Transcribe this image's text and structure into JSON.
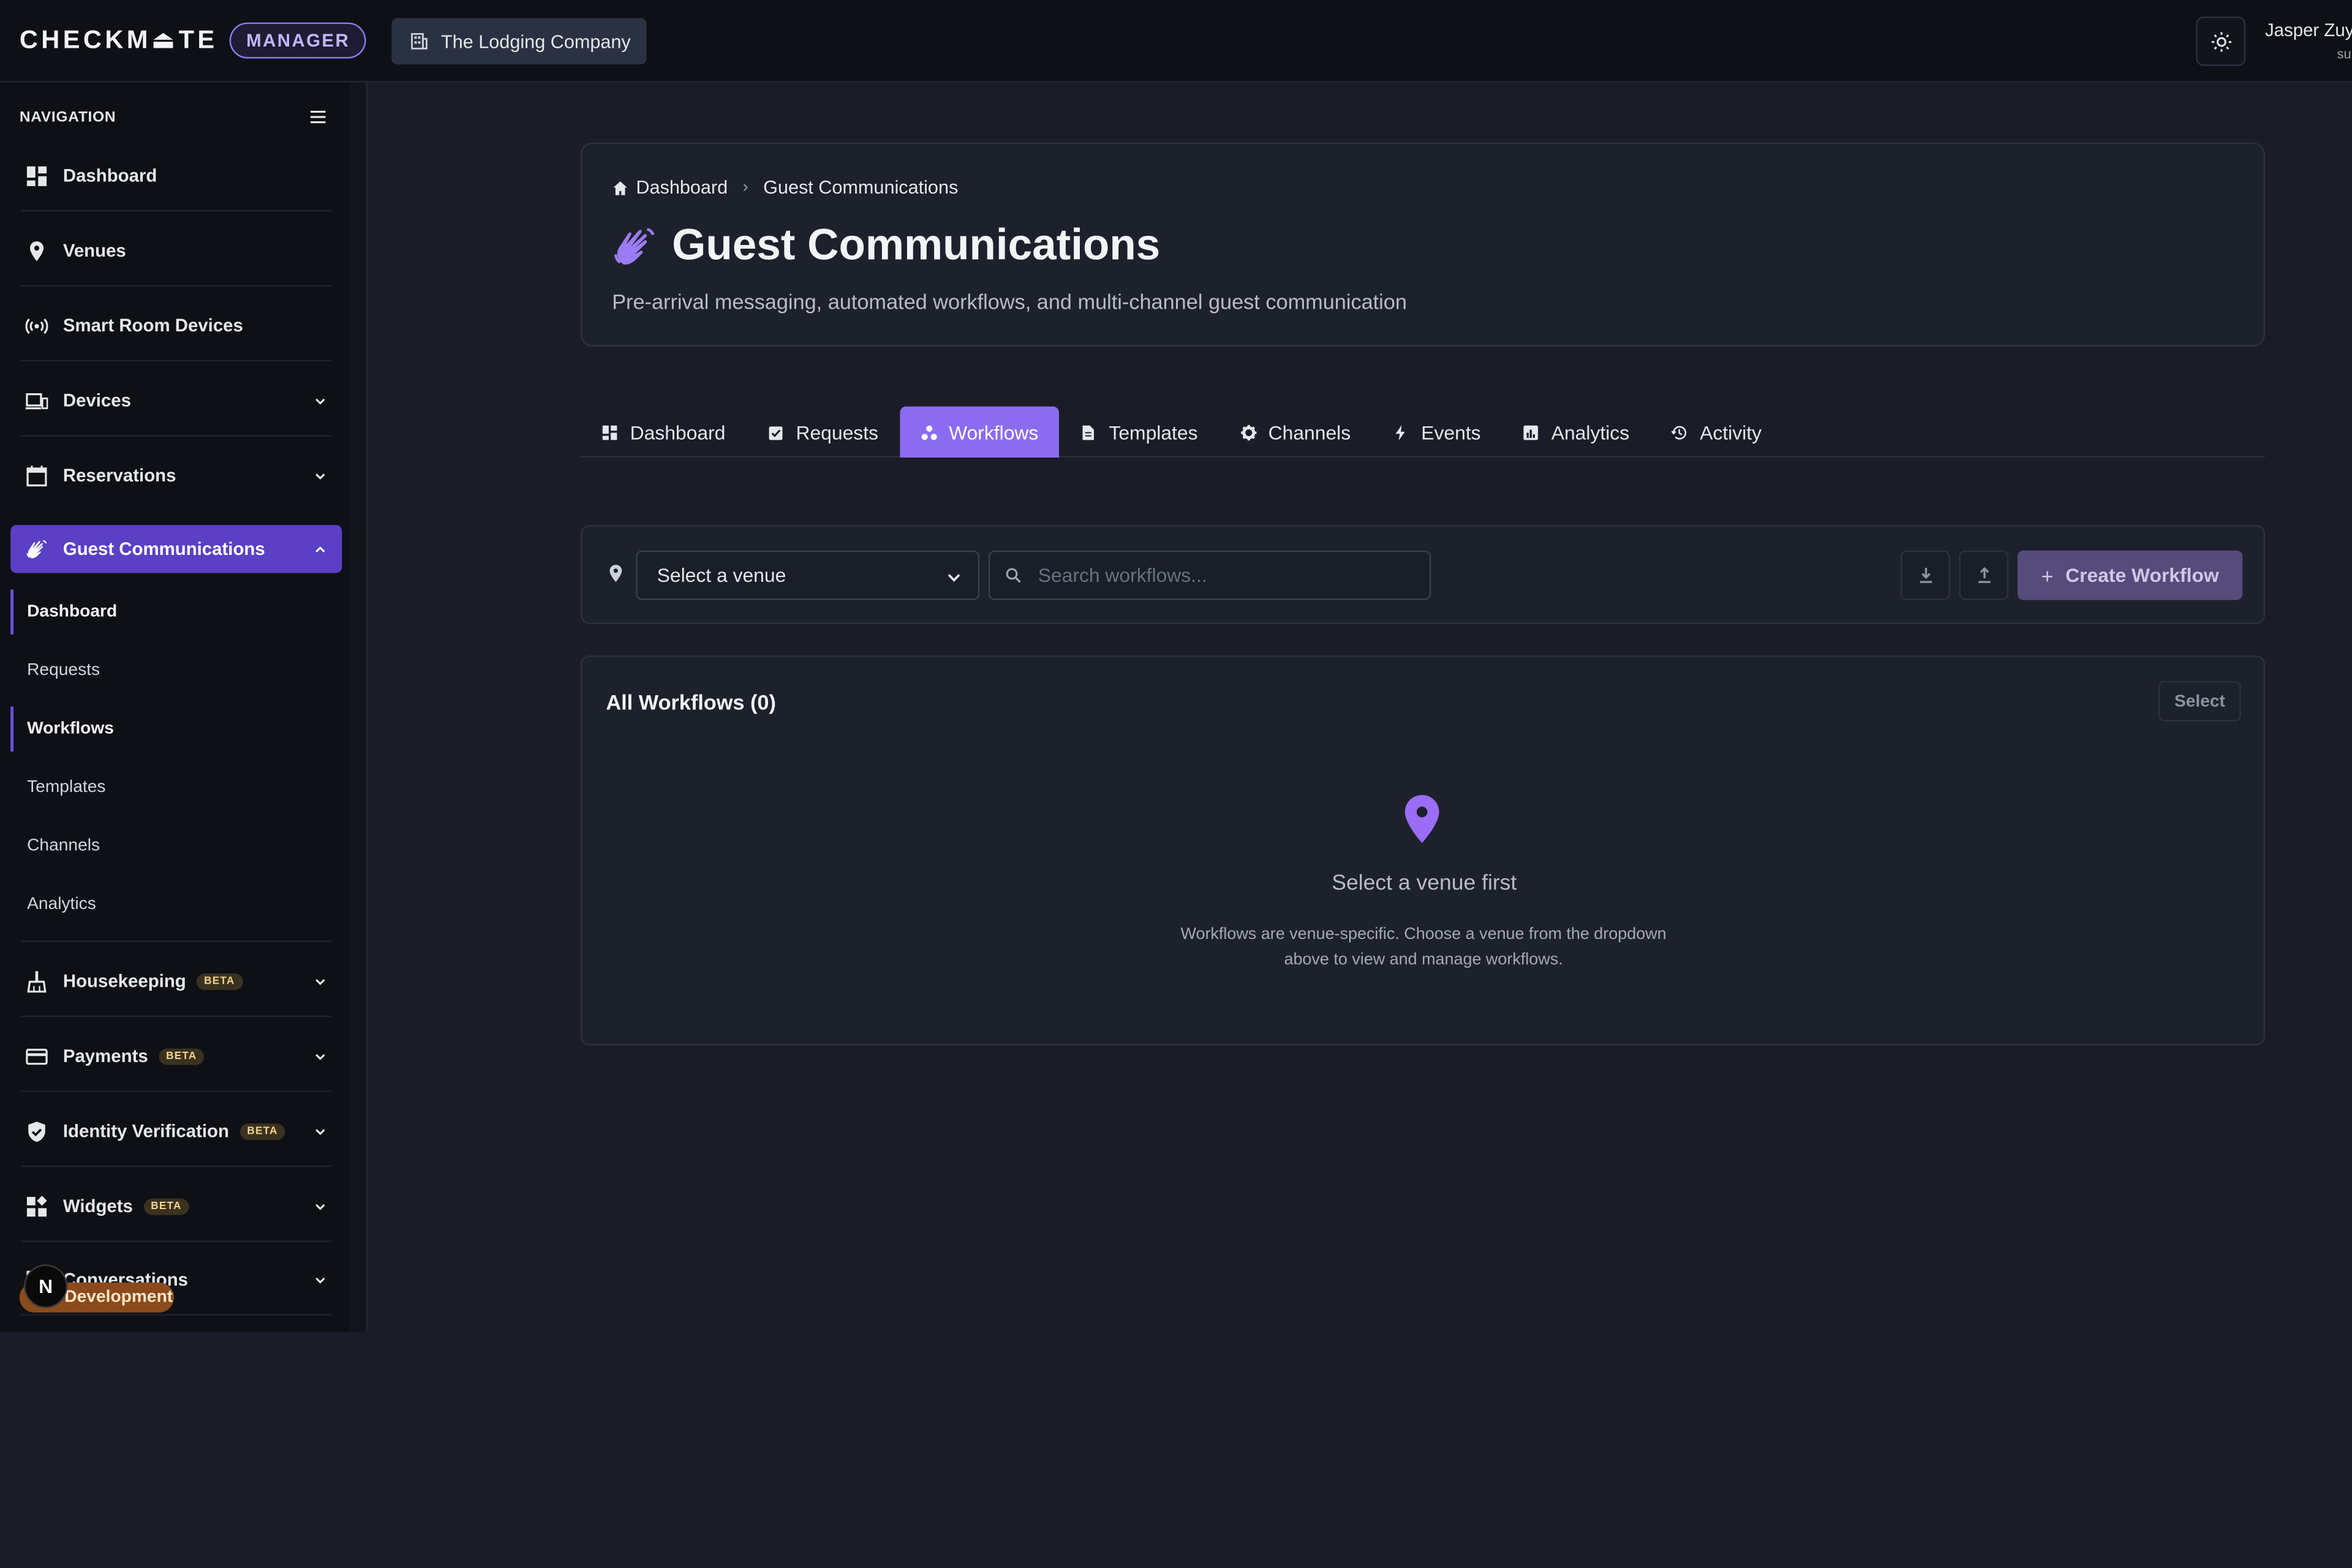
{
  "brand": {
    "logo": "CHECKM⏏TE",
    "badge": "MANAGER"
  },
  "org": {
    "name": "The Lodging Company"
  },
  "user": {
    "name": "Jasper Zuyd",
    "role": "su"
  },
  "sidebar": {
    "heading": "NAVIGATION",
    "items": [
      {
        "label": "Dashboard",
        "icon": "grid-icon"
      },
      {
        "label": "Venues",
        "icon": "pin-icon"
      },
      {
        "label": "Smart Room Devices",
        "icon": "signal-icon"
      },
      {
        "label": "Devices",
        "icon": "devices-icon"
      },
      {
        "label": "Reservations",
        "icon": "calendar-icon"
      },
      {
        "label": "Guest Communications",
        "icon": "wave-hand-icon"
      },
      {
        "label": "Housekeeping",
        "icon": "broom-icon",
        "badge": "BETA"
      },
      {
        "label": "Payments",
        "icon": "card-icon",
        "badge": "BETA"
      },
      {
        "label": "Identity Verification",
        "icon": "shield-icon",
        "badge": "BETA"
      },
      {
        "label": "Widgets",
        "icon": "widgets-icon",
        "badge": "BETA"
      },
      {
        "label": "Conversations",
        "icon": "chat-icon"
      }
    ],
    "sub_items": [
      "Dashboard",
      "Requests",
      "Workflows",
      "Templates",
      "Channels",
      "Analytics"
    ]
  },
  "dev_badge": {
    "label": "Development",
    "next_letter": "N"
  },
  "header": {
    "breadcrumb": [
      "Dashboard",
      "Guest Communications"
    ],
    "title": "Guest Communications",
    "subtitle": "Pre-arrival messaging, automated workflows, and multi-channel guest communication"
  },
  "tabs": [
    {
      "label": "Dashboard",
      "icon": "grid-icon"
    },
    {
      "label": "Requests",
      "icon": "check-square-icon"
    },
    {
      "label": "Workflows",
      "icon": "workflow-icon",
      "active": true
    },
    {
      "label": "Templates",
      "icon": "document-icon"
    },
    {
      "label": "Channels",
      "icon": "gear-icon"
    },
    {
      "label": "Events",
      "icon": "bolt-icon"
    },
    {
      "label": "Analytics",
      "icon": "chart-icon"
    },
    {
      "label": "Activity",
      "icon": "history-icon"
    }
  ],
  "toolbar": {
    "venue_select": "Select a venue",
    "search_placeholder": "Search workflows...",
    "create_label": "Create Workflow"
  },
  "workflows": {
    "title": "All Workflows (0)",
    "select_label": "Select",
    "empty_title": "Select a venue first",
    "empty_text": "Workflows are venue-specific. Choose a venue from the dropdown above to view and manage workflows."
  },
  "colors": {
    "accent": "#8b6cf0",
    "active_nav": "#5b3fc4",
    "background": "#1a1d27"
  }
}
